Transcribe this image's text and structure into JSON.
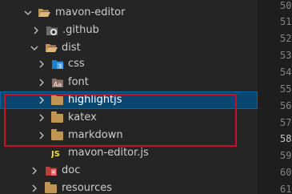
{
  "tree": {
    "root": {
      "label": "mavon-editor",
      "icon": "folder-open-icon",
      "expanded": true
    },
    "github": {
      "label": ".github",
      "icon": "github-folder-icon",
      "expanded": false
    },
    "dist": {
      "label": "dist",
      "icon": "folder-open-icon",
      "expanded": true
    },
    "css": {
      "label": "css",
      "icon": "css-folder-icon",
      "expanded": false
    },
    "font": {
      "label": "font",
      "icon": "font-folder-icon",
      "expanded": false
    },
    "highlightjs": {
      "label": "highlightjs",
      "icon": "folder-icon",
      "expanded": false,
      "selected": true
    },
    "katex": {
      "label": "katex",
      "icon": "folder-icon",
      "expanded": false
    },
    "markdown": {
      "label": "markdown",
      "icon": "folder-icon",
      "expanded": false
    },
    "mavon_js": {
      "label": "mavon-editor.js",
      "icon": "js-file-icon",
      "badge": "JS"
    },
    "doc": {
      "label": "doc",
      "icon": "doc-folder-icon",
      "expanded": false
    },
    "resources": {
      "label": "resources",
      "icon": "folder-icon",
      "expanded": false
    }
  },
  "line_numbers": [
    "50",
    "51",
    "52",
    "53",
    "54",
    "55",
    "56",
    "57",
    "58",
    "59",
    "60",
    "61"
  ],
  "current_line": "58",
  "colors": {
    "sidebar_bg": "#252526",
    "editor_bg": "#1e1e1e",
    "selection_bg": "#094771",
    "annotation_box": "#c8102e",
    "folder": "#c09553",
    "js_badge": "#f1dd35",
    "css_icon": "#42a5f5"
  }
}
